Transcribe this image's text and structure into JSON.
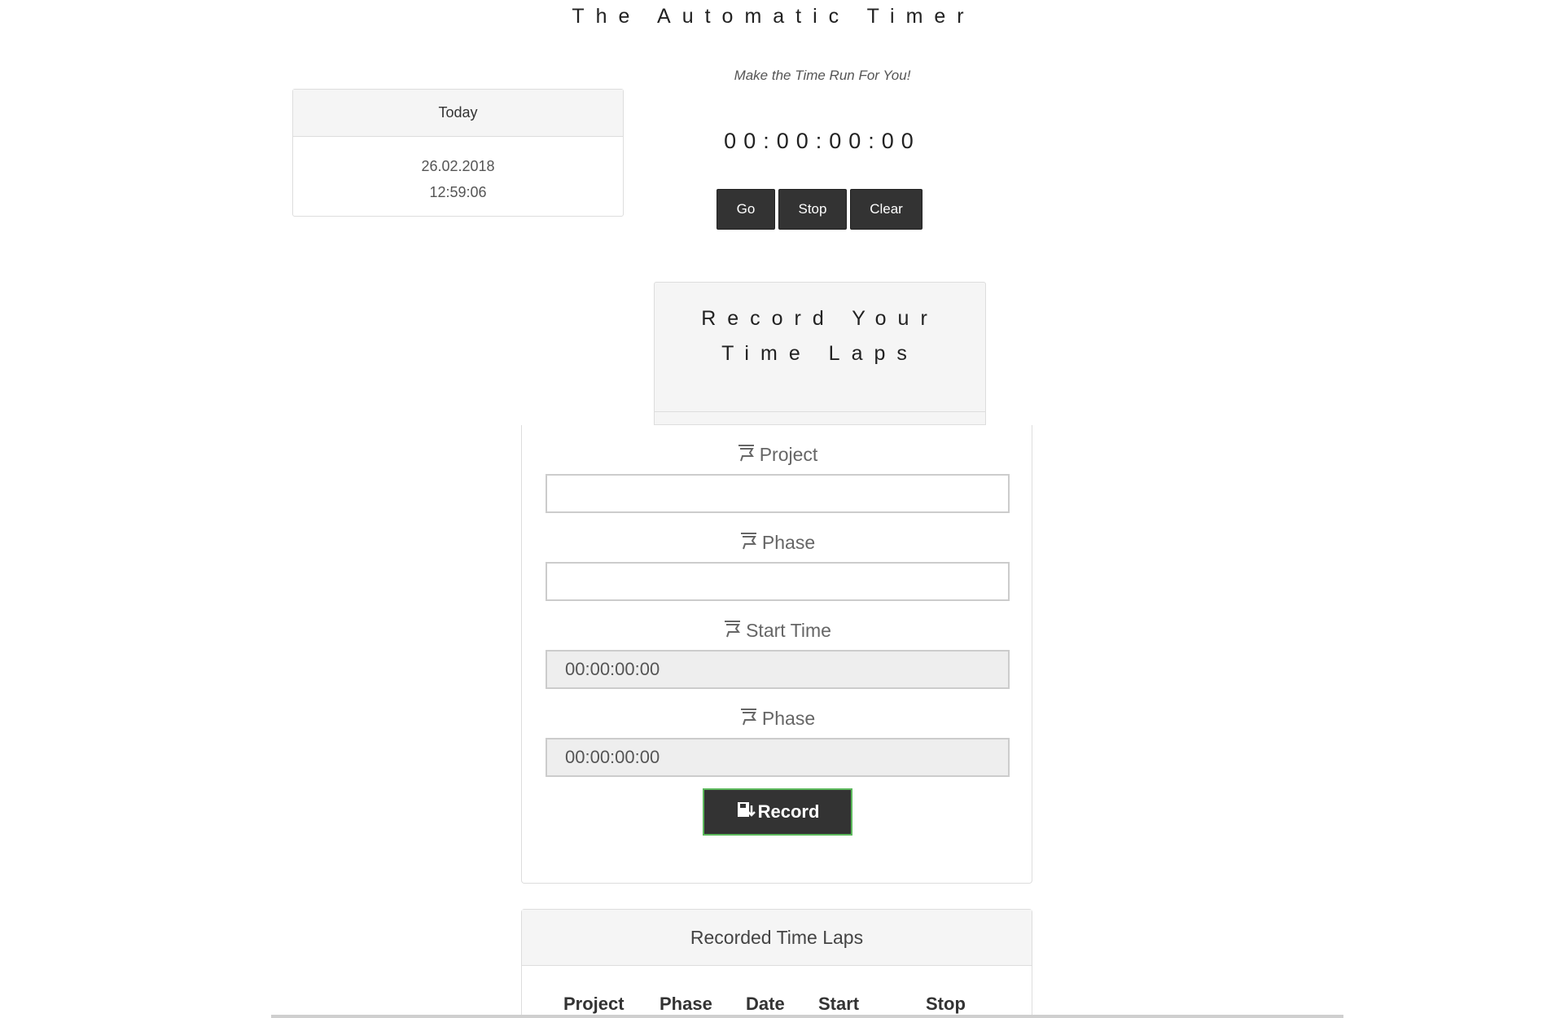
{
  "app": {
    "title": "The Automatic Timer",
    "tagline": "Make the Time Run For You!"
  },
  "today": {
    "header": "Today",
    "date": "26.02.2018",
    "time": "12:59:06"
  },
  "timer": {
    "display": "00:00:00:00",
    "go_label": "Go",
    "stop_label": "Stop",
    "clear_label": "Clear"
  },
  "record": {
    "heading_line1": "Record Your",
    "heading_line2": "Time Laps",
    "project_label": "Project",
    "project_value": "",
    "phase_label": "Phase",
    "phase_value": "",
    "start_label": "Start Time",
    "start_value": "00:00:00:00",
    "phase2_label": "Phase",
    "phase2_value": "00:00:00:00",
    "record_label": "Record"
  },
  "laps": {
    "header": "Recorded Time Laps",
    "columns": [
      "Project",
      "Phase",
      "Date",
      "Start",
      "Stop"
    ]
  }
}
